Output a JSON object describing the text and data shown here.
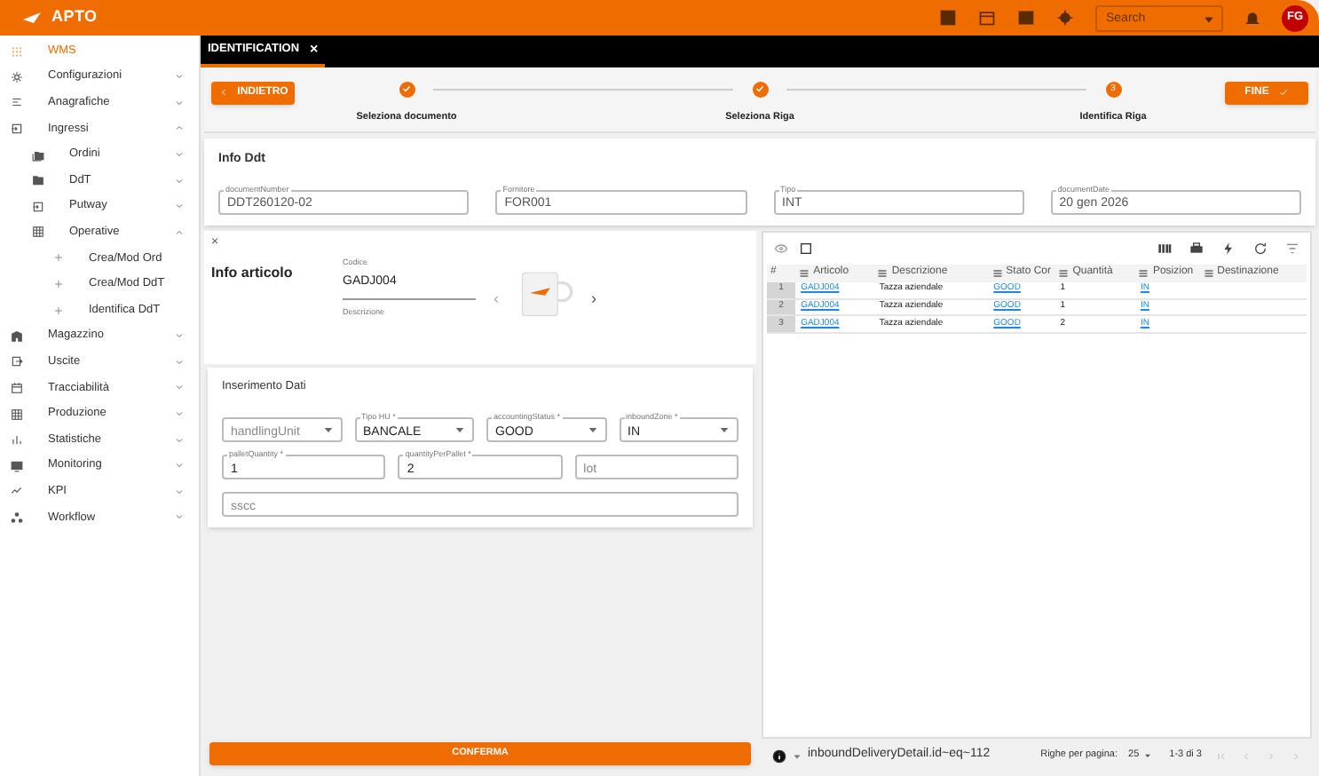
{
  "header": {
    "logo": "APTO",
    "search_placeholder": "Search",
    "avatar": "FG"
  },
  "sidebar": {
    "title": "WMS",
    "items": [
      {
        "label": "Configurazioni",
        "expanded": false
      },
      {
        "label": "Anagrafiche",
        "expanded": false
      },
      {
        "label": "Ingressi",
        "expanded": true,
        "children": [
          {
            "label": "Ordini",
            "expanded": false
          },
          {
            "label": "DdT",
            "expanded": false
          },
          {
            "label": "Putway",
            "expanded": false
          },
          {
            "label": "Operative",
            "expanded": true,
            "children": [
              {
                "label": "Crea/Mod Ord"
              },
              {
                "label": "Crea/Mod DdT"
              },
              {
                "label": "Identifica DdT"
              }
            ]
          }
        ]
      },
      {
        "label": "Magazzino",
        "expanded": false
      },
      {
        "label": "Uscite",
        "expanded": false
      },
      {
        "label": "Tracciabilità",
        "expanded": false
      },
      {
        "label": "Produzione",
        "expanded": false
      },
      {
        "label": "Statistiche",
        "expanded": false
      },
      {
        "label": "Monitoring",
        "expanded": false
      },
      {
        "label": "KPI",
        "expanded": false
      },
      {
        "label": "Workflow",
        "expanded": false
      }
    ]
  },
  "tabs": [
    {
      "label": "IDENTIFICATION",
      "selected": true,
      "close": "×"
    }
  ],
  "back_button": "INDIETRO",
  "finish_button": "FINE",
  "steps": [
    {
      "label": "Seleziona documento",
      "done": true
    },
    {
      "label": "Seleziona Riga",
      "done": true
    },
    {
      "label": "Identifica Riga",
      "done": false,
      "number": "3"
    }
  ],
  "info_ddt": {
    "title": "Info Ddt",
    "fields": [
      {
        "label": "documentNumber",
        "value": "DDT260120-02"
      },
      {
        "label": "Fornitore",
        "value": "FOR001"
      },
      {
        "label": "Tipo",
        "value": "INT"
      },
      {
        "label": "documentDate",
        "value": "20 gen 2026"
      }
    ]
  },
  "info_articolo": {
    "close": "×",
    "title": "Info articolo",
    "code_label": "Codice",
    "code": "GADJ004",
    "description_label": "Descrizione",
    "prev": "‹",
    "next": "›"
  },
  "inserimento": {
    "title": "Inserimento Dati",
    "fields": [
      {
        "kind": "select",
        "placeholder": "handlingUnit"
      },
      {
        "kind": "select",
        "label": "Tipo HU *",
        "value": "BANCALE"
      },
      {
        "kind": "select",
        "label": "accountingStatus *",
        "value": "GOOD"
      },
      {
        "kind": "select",
        "label": "inboundZone *",
        "value": "IN"
      },
      {
        "kind": "text",
        "label": "palletQuantity *",
        "value": "1"
      },
      {
        "kind": "text",
        "label": "quantityPerPallet *",
        "value": "2"
      },
      {
        "kind": "text",
        "placeholder": "lot"
      },
      {
        "kind": "wide",
        "placeholder": "sscc"
      }
    ]
  },
  "confirm_button": "CONFERMA",
  "table": {
    "columns": [
      "#",
      "Articolo",
      "Descrizione",
      "Stato Cor",
      "Quantità",
      "Posizion",
      "Destinazione"
    ],
    "rows": [
      [
        "1",
        "GADJ004",
        "Tazza aziendale",
        "GOOD",
        "1",
        "IN",
        ""
      ],
      [
        "2",
        "GADJ004",
        "Tazza aziendale",
        "GOOD",
        "1",
        "IN",
        ""
      ],
      [
        "3",
        "GADJ004",
        "Tazza aziendale",
        "GOOD",
        "2",
        "IN",
        ""
      ]
    ],
    "filter": "inboundDeliveryDetail.id~eq~112",
    "rows_per_page_label": "Righe per pagina:",
    "rows_per_page": "25",
    "range": "1-3 di 3"
  }
}
